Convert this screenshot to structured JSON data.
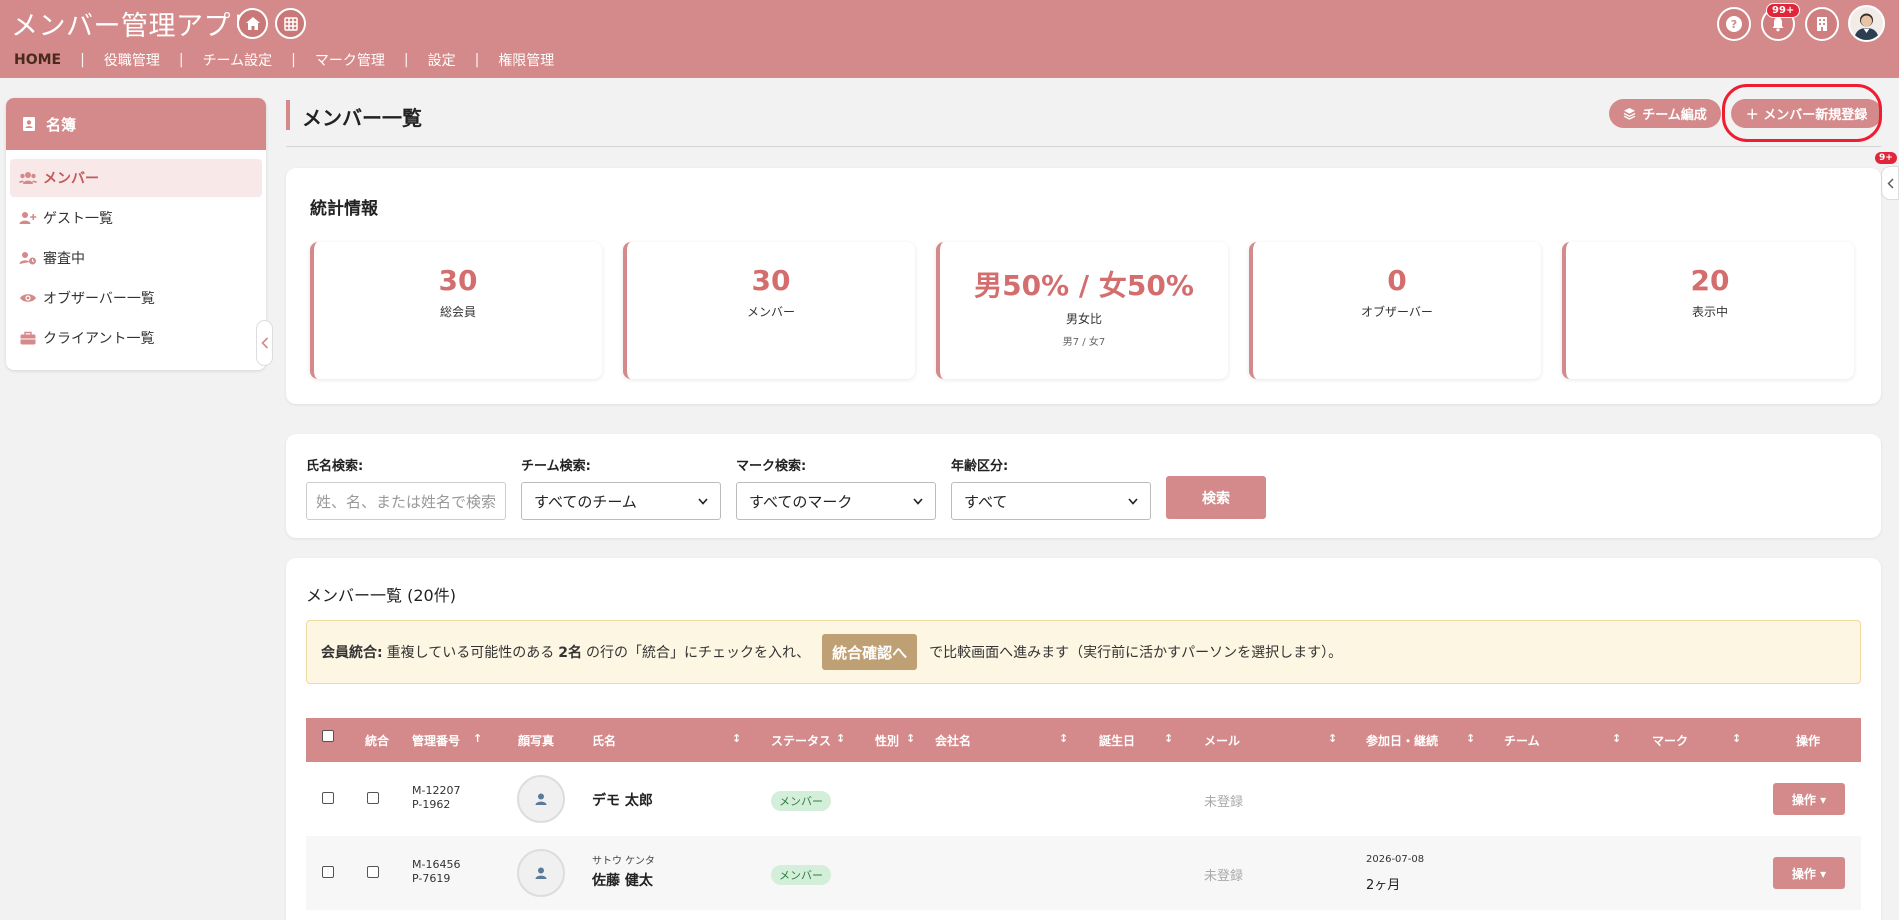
{
  "app": {
    "title": "メンバー管理アプリ"
  },
  "nav": {
    "items": [
      {
        "label": "HOME"
      },
      {
        "label": "役職管理"
      },
      {
        "label": "チーム設定"
      },
      {
        "label": "マーク管理"
      },
      {
        "label": "設定"
      },
      {
        "label": "権限管理"
      }
    ],
    "separator": "|"
  },
  "header": {
    "notification_badge": "99+"
  },
  "sidebar": {
    "title": "名簿",
    "items": [
      {
        "label": "メンバー"
      },
      {
        "label": "ゲスト一覧"
      },
      {
        "label": "審査中"
      },
      {
        "label": "オブザーバー一覧"
      },
      {
        "label": "クライアント一覧"
      }
    ]
  },
  "page": {
    "title": "メンバー一覧",
    "team_button": "チーム編成",
    "new_member_button": "＋ メンバー新規登録",
    "side_badge": "9+"
  },
  "stats": {
    "title": "統計情報",
    "boxes": [
      {
        "value": "30",
        "label": "総会員"
      },
      {
        "value": "30",
        "label": "メンバー"
      },
      {
        "value": "男50% / 女50%",
        "label": "男女比",
        "sub": "男7 / 女7"
      },
      {
        "value": "0",
        "label": "オブザーバー"
      },
      {
        "value": "20",
        "label": "表示中"
      }
    ]
  },
  "search": {
    "name_label": "氏名検索:",
    "name_placeholder": "姓、名、または姓名で検索",
    "team_label": "チーム検索:",
    "team_value": "すべてのチーム",
    "mark_label": "マーク検索:",
    "mark_value": "すべてのマーク",
    "age_label": "年齢区分:",
    "age_value": "すべて",
    "button": "検索"
  },
  "list": {
    "title": "メンバー一覧 (20件)",
    "merge_bold": "会員統合:",
    "merge_text1": "重複している可能性のある",
    "merge_count": "2名",
    "merge_text2": "の行の「統合」にチェックを入れ、",
    "merge_button": "統合確認へ",
    "merge_text3": "で比較画面へ進みます（実行前に活かすパーソンを選択します）。",
    "columns": {
      "merge": "統合",
      "mgr_no": "管理番号",
      "photo": "顔写真",
      "name": "氏名",
      "status": "ステータス",
      "gender": "性別",
      "company": "会社名",
      "birthday": "誕生日",
      "email": "メール",
      "joined": "参加日・継続",
      "team": "チーム",
      "mark": "マーク",
      "action": "操作"
    },
    "sort_asc": "↑",
    "sort_both": "↕",
    "rows": [
      {
        "mgr_m": "M-12207",
        "mgr_p": "P-1962",
        "kana": "",
        "name": "デモ 太郎",
        "status": "メンバー",
        "email": "未登録",
        "joined_date": "",
        "joined_duration": "",
        "action": "操作 ▾"
      },
      {
        "mgr_m": "M-16456",
        "mgr_p": "P-7619",
        "kana": "サトウ ケンタ",
        "name": "佐藤 健太",
        "status": "メンバー",
        "email": "未登録",
        "joined_date": "2026-07-08",
        "joined_duration": "2ヶ月",
        "action": "操作 ▾"
      }
    ]
  },
  "icons": {
    "home": "home-icon",
    "grid": "grid-icon",
    "help": "help-icon",
    "bell": "bell-icon",
    "building": "building-icon",
    "avatar": "avatar"
  },
  "colors": {
    "brand": "#d48a8a",
    "accent_text": "#d46e6e",
    "highlight_ring": "#ee1d32",
    "notice_bg": "#fdf6e3",
    "merge_button": "#bfa074",
    "status_bg": "#d3eed9"
  }
}
